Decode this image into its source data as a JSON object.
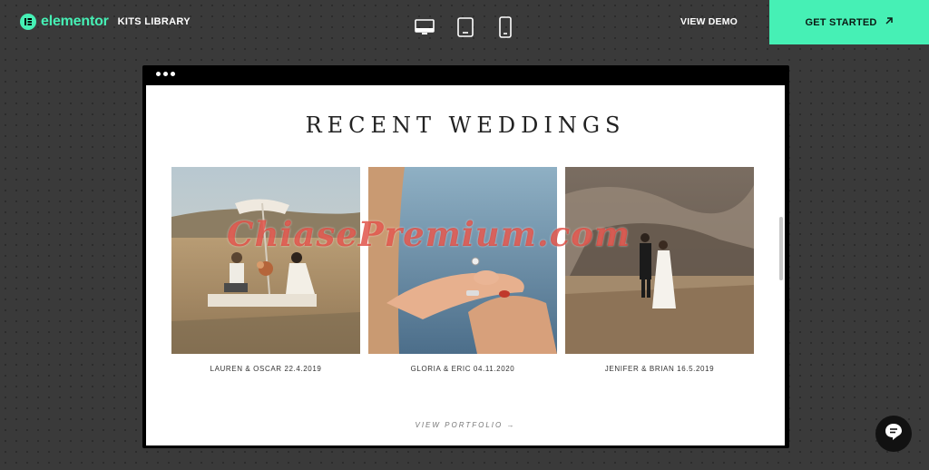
{
  "header": {
    "brand": "elementor",
    "section_label": "KITS LIBRARY",
    "view_demo": "VIEW DEMO",
    "get_started": "GET STARTED",
    "devices": [
      "desktop-icon",
      "tablet-icon",
      "mobile-icon"
    ],
    "accent_color": "#46f0b5"
  },
  "preview": {
    "heading": "RECENT WEDDINGS",
    "gallery": [
      {
        "caption": "LAUREN & OSCAR 22.4.2019"
      },
      {
        "caption": "GLORIA & ERIC 04.11.2020"
      },
      {
        "caption": "JENIFER & BRIAN 16.5.2019"
      }
    ],
    "portfolio_link": "VIEW PORTFOLIO →"
  },
  "watermark": "ChiasePremium.com",
  "chat": {
    "icon": "chat-icon"
  }
}
